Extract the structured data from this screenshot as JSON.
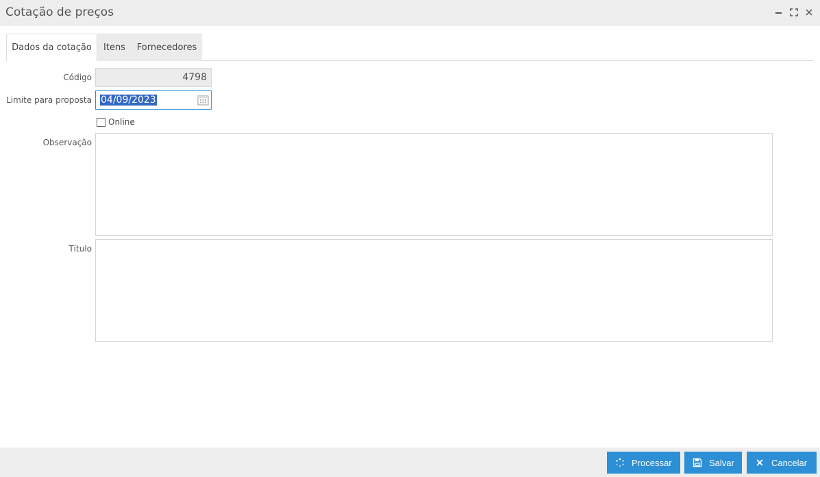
{
  "window": {
    "title": "Cotação de preços",
    "controls": [
      "minimize-icon",
      "maximize-icon",
      "close-icon"
    ]
  },
  "tabs": [
    {
      "label": "Dados da cotação",
      "active": true
    },
    {
      "label": "Itens",
      "active": false
    },
    {
      "label": "Fornecedores",
      "active": false
    }
  ],
  "form": {
    "codigo": {
      "label": "Código",
      "value": "4798",
      "readonly": true
    },
    "limite": {
      "label": "Limite para proposta",
      "value": "04/09/2023",
      "icon": "calendar-icon"
    },
    "online": {
      "label": "Online",
      "checked": false
    },
    "observacao": {
      "label": "Observação",
      "value": ""
    },
    "titulo": {
      "label": "Título",
      "value": ""
    }
  },
  "footer": {
    "processar": {
      "label": "Processar",
      "icon": "spinner-icon"
    },
    "salvar": {
      "label": "Salvar",
      "icon": "floppy-disk-icon"
    },
    "cancelar": {
      "label": "Cancelar",
      "icon": "close-icon"
    }
  },
  "colors": {
    "accent": "#2d8fd5",
    "selection": "#3367c4",
    "titlebar": "#efefef"
  }
}
